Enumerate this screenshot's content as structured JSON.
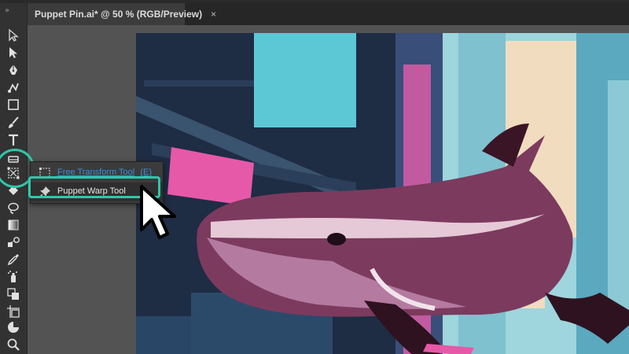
{
  "document_tab": {
    "title": "Puppet Pin.ai* @ 50 % (RGB/Preview)",
    "close_glyph": "×"
  },
  "toolbar": {
    "collapse_glyph": "»",
    "tools": [
      "selection-tool",
      "direct-selection-tool",
      "pen-tool",
      "curvature-tool",
      "rectangle-tool",
      "paintbrush-tool",
      "type-tool",
      "eraser-tool",
      "free-transform-tool",
      "shape-builder-tool",
      "lasso-tool",
      "gradient-tool",
      "blend-tool",
      "eyedropper-tool",
      "symbol-sprayer-tool",
      "live-paint-tool",
      "artboard-tool",
      "pie-chart-tool",
      "zoom-tool"
    ]
  },
  "flyout": {
    "items": [
      {
        "label": "Free Transform Tool",
        "shortcut": "(E)",
        "icon": "free-transform-icon"
      },
      {
        "label": "Puppet Warp Tool",
        "shortcut": "",
        "icon": "pushpin-icon"
      }
    ]
  },
  "colors": {
    "highlight": "#2fc7a9",
    "link": "#3d8fd6",
    "whale": "#7c3a5e",
    "sky": "#5cc8d6",
    "building": "#1e2c44"
  }
}
